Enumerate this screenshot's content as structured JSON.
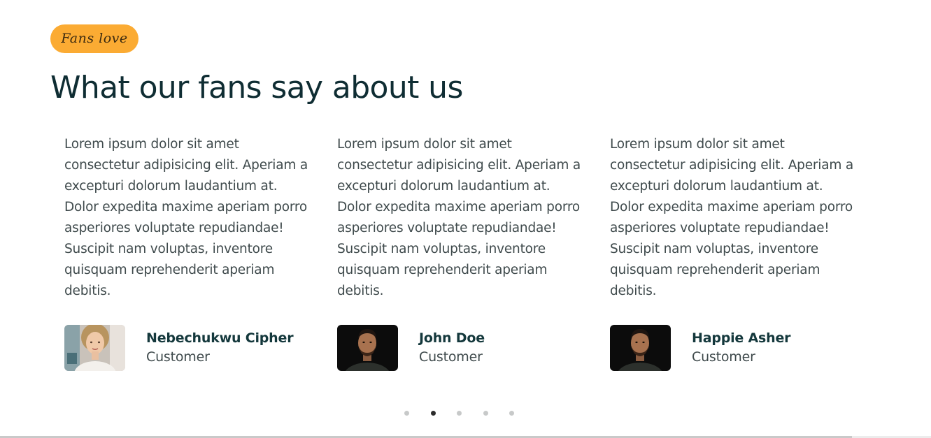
{
  "section": {
    "badge": "Fans love",
    "heading": "What our fans say about us"
  },
  "testimonials": [
    {
      "quote": "Lorem ipsum dolor sit amet consectetur adipisicing elit. Aperiam a excepturi dolorum laudantium at. Dolor expedita maxime aperiam porro asperiores voluptate repudiandae! Suscipit nam voluptas, inventore quisquam reprehenderit aperiam debitis.",
      "name": "Nebechukwu Cipher",
      "role": "Customer",
      "avatar": "woman-portrait"
    },
    {
      "quote": "Lorem ipsum dolor sit amet consectetur adipisicing elit. Aperiam a excepturi dolorum laudantium at. Dolor expedita maxime aperiam porro asperiores voluptate repudiandae! Suscipit nam voluptas, inventore quisquam reprehenderit aperiam debitis.",
      "name": "John Doe",
      "role": "Customer",
      "avatar": "man-portrait"
    },
    {
      "quote": "Lorem ipsum dolor sit amet consectetur adipisicing elit. Aperiam a excepturi dolorum laudantium at. Dolor expedita maxime aperiam porro asperiores voluptate repudiandae! Suscipit nam voluptas, inventore quisquam reprehenderit aperiam debitis.",
      "name": "Happie Asher",
      "role": "Customer",
      "avatar": "man-portrait"
    }
  ],
  "pagination": {
    "total": 5,
    "active": 2
  },
  "colors": {
    "badge_bg": "#fbab33",
    "heading": "#0f2d33",
    "text": "#3f4a4c",
    "dot": "#c7c9c9",
    "dot_active": "#2b2b2b"
  }
}
